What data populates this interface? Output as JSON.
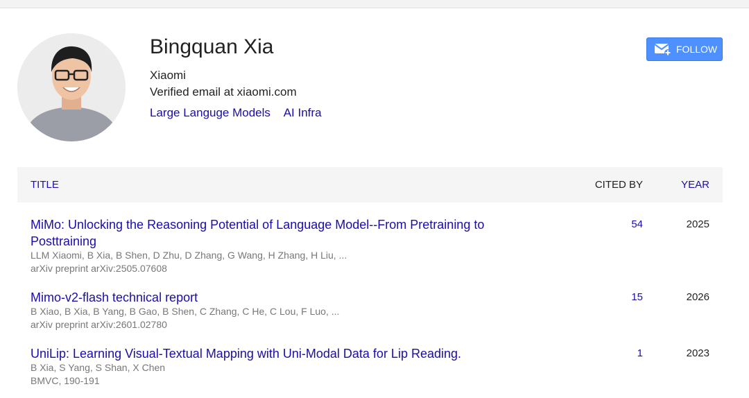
{
  "profile": {
    "name": "Bingquan Xia",
    "affiliation": "Xiaomi",
    "email": "Verified email at xiaomi.com",
    "interests": [
      "Large Languge Models",
      "AI Infra"
    ],
    "follow_label": "FOLLOW"
  },
  "table": {
    "headers": {
      "title": "TITLE",
      "cited_by": "CITED BY",
      "year": "YEAR"
    },
    "rows": [
      {
        "title": "MiMo: Unlocking the Reasoning Potential of Language Model--From Pretraining to Posttraining",
        "authors": "LLM Xiaomi, B Xia, B Shen, D Zhu, D Zhang, G Wang, H Zhang, H Liu, ...",
        "venue": "arXiv preprint arXiv:2505.07608",
        "cited_by": "54",
        "year": "2025"
      },
      {
        "title": "Mimo-v2-flash technical report",
        "authors": "B Xiao, B Xia, B Yang, B Gao, B Shen, C Zhang, C He, C Lou, F Luo, ...",
        "venue": "arXiv preprint arXiv:2601.02780",
        "cited_by": "15",
        "year": "2026"
      },
      {
        "title": "UniLip: Learning Visual-Textual Mapping with Uni-Modal Data for Lip Reading.",
        "authors": "B Xia, S Yang, S Shan, X Chen",
        "venue": "BMVC, 190-191",
        "cited_by": "1",
        "year": "2023"
      }
    ]
  },
  "colors": {
    "link": "#1a0dab",
    "follow_button": "#4d90fe",
    "header_bg": "#f5f5f5"
  },
  "icons": {
    "follow": "mail-plus-icon",
    "avatar": "profile-photo"
  }
}
